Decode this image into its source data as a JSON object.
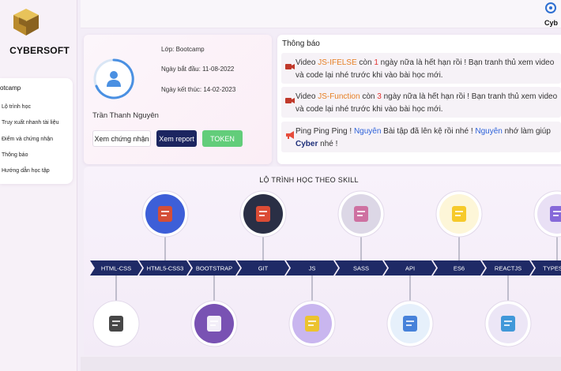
{
  "sidebar": {
    "brand": "CYBERSOFT",
    "menu_title": "otcamp",
    "items": [
      {
        "label": "Lộ trình học"
      },
      {
        "label": "Truy xuất nhanh tài liệu"
      },
      {
        "label": "Điểm và chứng nhận"
      },
      {
        "label": "Thông báo"
      },
      {
        "label": "Hướng dẫn học tập"
      }
    ]
  },
  "corner": {
    "label": "Cyb"
  },
  "profile": {
    "name": "Trần Thanh Nguyên",
    "class_line": "Lớp: Bootcamp",
    "start_line": "Ngày bắt đầu: 11-08-2022",
    "end_line": "Ngày kết thúc: 14-02-2023",
    "buttons": {
      "certificate": "Xem chứng nhận",
      "report": "Xem report",
      "token": "TOKEN"
    }
  },
  "notifications": {
    "title": "Thông báo",
    "items": [
      {
        "icon": "video-icon",
        "p1": "Video ",
        "name": "JS-IFELSE",
        "p2": " còn ",
        "days": "1",
        "p3": " ngày nữa là hết hạn rồi ! Bạn tranh thủ xem video và code lại nhé trước khi vào bài học mới."
      },
      {
        "icon": "video-icon",
        "p1": "Video ",
        "name": "JS-Function",
        "p2": " còn ",
        "days": "3",
        "p3": " ngày nữa là hết hạn rồi ! Bạn tranh thủ xem video và code lại nhé trước khi vào bài học mới."
      },
      {
        "icon": "megaphone-icon",
        "p1": "Ping Ping Ping ! ",
        "user1": "Nguyên",
        "p2": " Bài tập đã lên kệ rồi nhé ! ",
        "user2": "Nguyên",
        "p3": " nhớ làm giúp ",
        "brand": "Cyber",
        "p4": " nhé !"
      }
    ]
  },
  "skills": {
    "title": "LỘ TRÌNH HỌC THEO SKILL",
    "items": [
      {
        "label": "HTML-CSS",
        "icon": "html-css-icon",
        "row": "bottom"
      },
      {
        "label": "HTML5-CSS3",
        "icon": "html5-css3-icon",
        "row": "top"
      },
      {
        "label": "BOOTSTRAP",
        "icon": "bootstrap-icon",
        "row": "bottom"
      },
      {
        "label": "GIT",
        "icon": "git-icon",
        "row": "top"
      },
      {
        "label": "JS",
        "icon": "javascript-icon",
        "row": "bottom"
      },
      {
        "label": "SASS",
        "icon": "sass-icon",
        "row": "top"
      },
      {
        "label": "API",
        "icon": "api-icon",
        "row": "bottom"
      },
      {
        "label": "ES6",
        "icon": "es6-icon",
        "row": "top"
      },
      {
        "label": "REACTJS",
        "icon": "react-icon",
        "row": "bottom"
      },
      {
        "label": "TYPESCR",
        "icon": "typescript-icon",
        "row": "top"
      }
    ]
  },
  "colors": {
    "ribbon": "#1f2a66",
    "accent_green": "#62cd7a",
    "accent_navy": "#1c2560",
    "ring_blue": "#4a90e2"
  }
}
